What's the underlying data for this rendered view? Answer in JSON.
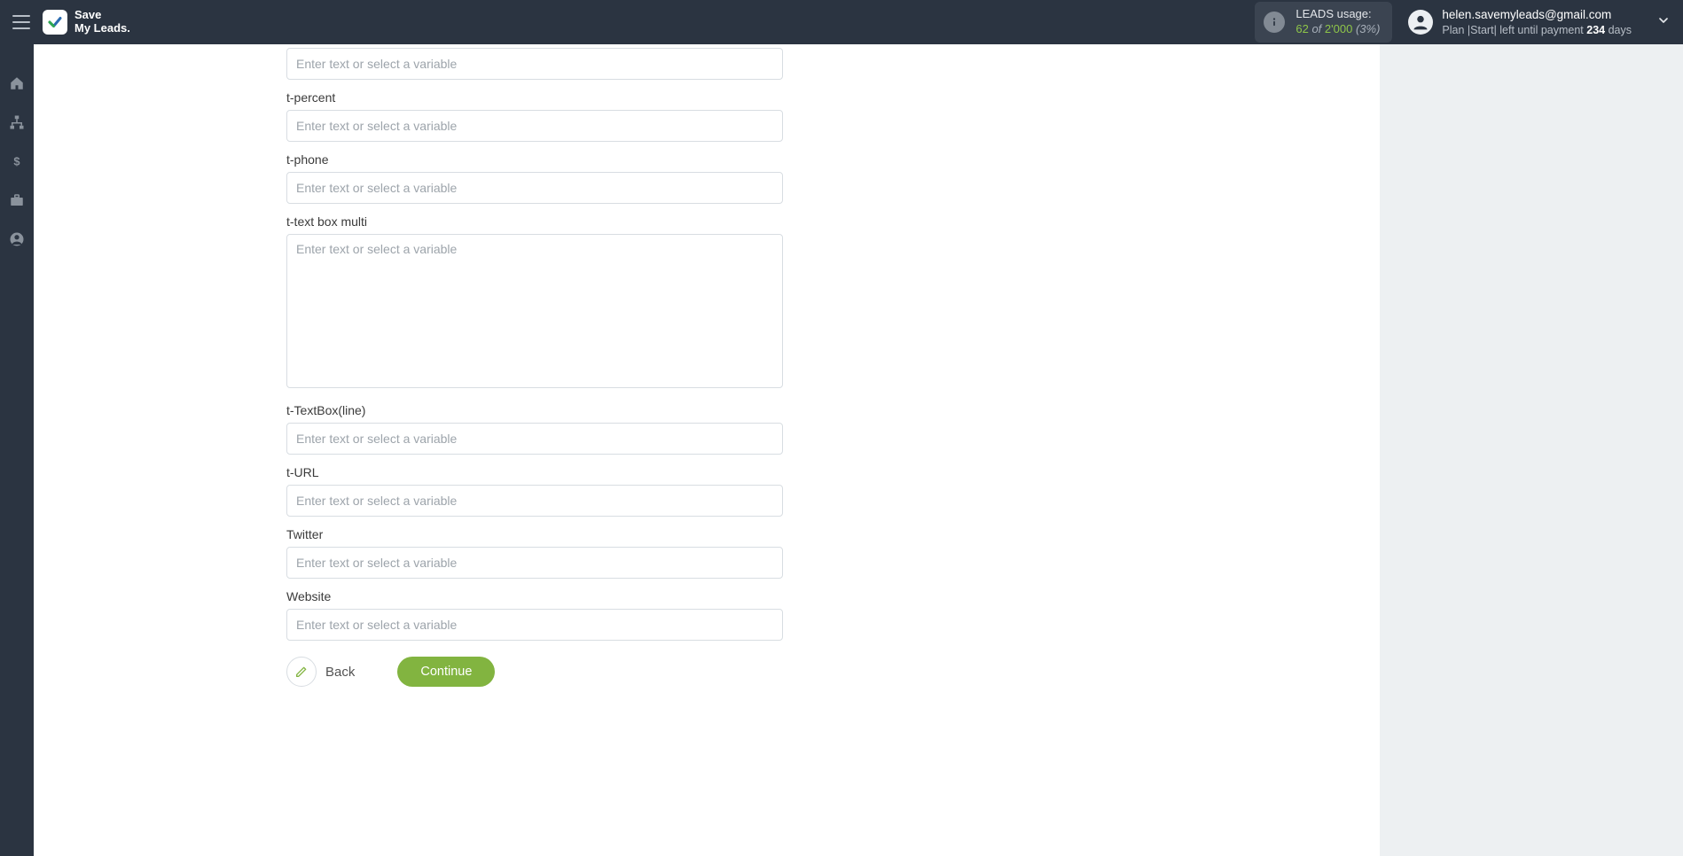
{
  "brand": {
    "line1": "Save",
    "line2": "My Leads."
  },
  "usage": {
    "label": "LEADS usage:",
    "value": "62",
    "of": "of",
    "limit": "2'000",
    "pct": "(3%)"
  },
  "user": {
    "email": "helen.savemyleads@gmail.com",
    "plan_prefix": "Plan |",
    "plan_name": "Start",
    "plan_mid": "| left until payment ",
    "days_num": "234",
    "days_suffix": " days"
  },
  "placeholder": "Enter text or select a variable",
  "fields": [
    {
      "label": "",
      "type": "text"
    },
    {
      "label": "t-percent",
      "type": "text"
    },
    {
      "label": "t-phone",
      "type": "text"
    },
    {
      "label": "t-text box multi",
      "type": "textarea"
    },
    {
      "label": "t-TextBox(line)",
      "type": "text"
    },
    {
      "label": "t-URL",
      "type": "text"
    },
    {
      "label": "Twitter",
      "type": "text"
    },
    {
      "label": "Website",
      "type": "text"
    }
  ],
  "buttons": {
    "back": "Back",
    "continue": "Continue"
  },
  "colors": {
    "accent": "#82b440",
    "header": "#2b3441"
  }
}
